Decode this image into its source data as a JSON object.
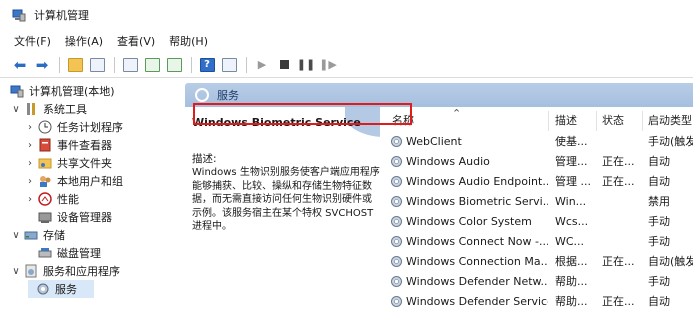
{
  "window": {
    "title": "计算机管理"
  },
  "menu": [
    "文件(F)",
    "操作(A)",
    "查看(V)",
    "帮助(H)"
  ],
  "toolbar": [
    "back-icon",
    "forward-icon",
    "folder-icon",
    "console-icon",
    "properties-icon",
    "refresh-icon",
    "export-icon",
    "help-icon",
    "view-icon",
    "play-icon",
    "stop-icon",
    "pause-icon",
    "restart-icon"
  ],
  "tree": {
    "root": "计算机管理(本地)",
    "system_tools": "系统工具",
    "task_scheduler": "任务计划程序",
    "event_viewer": "事件查看器",
    "shared_folders": "共享文件夹",
    "local_users": "本地用户和组",
    "performance": "性能",
    "device_manager": "设备管理器",
    "storage": "存储",
    "disk_management": "磁盘管理",
    "services_apps": "服务和应用程序",
    "services": "服务"
  },
  "panel": {
    "header": "服务",
    "selected_title": "Windows Biometric Service",
    "desc_label": "描述:",
    "desc_text": "Windows 生物识别服务使客户端应用程序能够捕获、比较、操纵和存储生物特征数据，而无需直接访问任何生物识别硬件或示例。该服务宿主在某个特权 SVCHOST 进程中。"
  },
  "columns": {
    "name": "名称",
    "desc": "描述",
    "status": "状态",
    "startup": "启动类型"
  },
  "services": [
    {
      "name": "WebClient",
      "desc": "使基...",
      "status": "",
      "startup": "手动(触发"
    },
    {
      "name": "Windows Audio",
      "desc": "管理...",
      "status": "正在...",
      "startup": "自动"
    },
    {
      "name": "Windows Audio Endpoint...",
      "desc": "管理 ...",
      "status": "正在...",
      "startup": "自动"
    },
    {
      "name": "Windows Biometric Servi...",
      "desc": "Win...",
      "status": "",
      "startup": "禁用"
    },
    {
      "name": "Windows Color System",
      "desc": "Wcs...",
      "status": "",
      "startup": "手动"
    },
    {
      "name": "Windows Connect Now -...",
      "desc": "WC...",
      "status": "",
      "startup": "手动"
    },
    {
      "name": "Windows Connection Ma...",
      "desc": "根据...",
      "status": "正在...",
      "startup": "自动(触发"
    },
    {
      "name": "Windows Defender Netw...",
      "desc": "帮助...",
      "status": "",
      "startup": "手动"
    },
    {
      "name": "Windows Defender Service",
      "desc": "帮助...",
      "status": "正在...",
      "startup": "自动"
    }
  ]
}
